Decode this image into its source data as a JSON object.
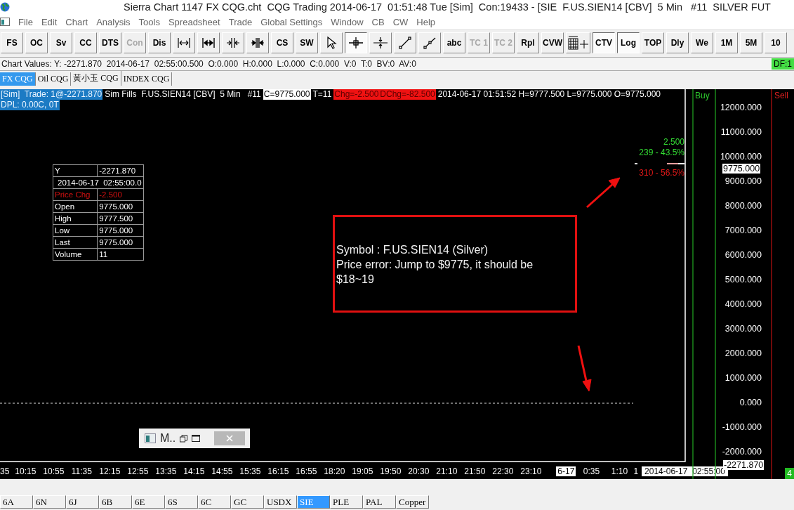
{
  "window": {
    "title": "Sierra Chart 1147 FX CQG.cht  CQG Trading 2014-06-17  01:51:48 Tue [Sim]  Con:19433 - [SIE  F.US.SIEN14 [CBV]  5 Min   #11  SILVER FUT"
  },
  "menu": {
    "items": [
      "File",
      "Edit",
      "Chart",
      "Analysis",
      "Tools",
      "Spreadsheet",
      "Trade",
      "Global Settings",
      "Window",
      "CB",
      "CW",
      "Help"
    ]
  },
  "toolbar": {
    "buttons": [
      {
        "kind": "text",
        "label": "FS",
        "disabled": false,
        "pressed": false
      },
      {
        "kind": "text",
        "label": "OC",
        "disabled": false,
        "pressed": false
      },
      {
        "kind": "text",
        "label": "Sv",
        "disabled": false,
        "pressed": false
      },
      {
        "kind": "text",
        "label": "CC",
        "disabled": false,
        "pressed": false
      },
      {
        "kind": "text",
        "label": "DTS",
        "disabled": false,
        "pressed": false
      },
      {
        "kind": "text",
        "label": "Con",
        "disabled": true,
        "pressed": false
      },
      {
        "kind": "text",
        "label": "Dis",
        "disabled": false,
        "pressed": false
      },
      {
        "kind": "expand",
        "disabled": false,
        "pressed": false
      },
      {
        "kind": "expandbold",
        "disabled": false,
        "pressed": false
      },
      {
        "kind": "compress",
        "disabled": false,
        "pressed": false
      },
      {
        "kind": "compressbold",
        "disabled": false,
        "pressed": false
      },
      {
        "kind": "text",
        "label": "CS",
        "disabled": false,
        "pressed": false
      },
      {
        "kind": "text",
        "label": "SW",
        "disabled": false,
        "pressed": false
      },
      {
        "kind": "pointer",
        "disabled": false,
        "pressed": false
      },
      {
        "kind": "crosshair",
        "disabled": false,
        "pressed": true
      },
      {
        "kind": "cross",
        "disabled": false,
        "pressed": false
      },
      {
        "kind": "line",
        "disabled": false,
        "pressed": false
      },
      {
        "kind": "ray",
        "disabled": false,
        "pressed": false
      },
      {
        "kind": "text",
        "label": "abc",
        "disabled": false,
        "pressed": false
      },
      {
        "kind": "text",
        "label": "TC 1",
        "disabled": true,
        "pressed": false
      },
      {
        "kind": "text",
        "label": "TC 2",
        "disabled": true,
        "pressed": false
      },
      {
        "kind": "text",
        "label": "Rpl",
        "disabled": false,
        "pressed": false
      },
      {
        "kind": "text",
        "label": "CVW",
        "disabled": false,
        "pressed": false
      },
      {
        "kind": "grid",
        "disabled": false,
        "pressed": false
      },
      {
        "kind": "text",
        "label": "CTV",
        "disabled": false,
        "pressed": true
      },
      {
        "kind": "text",
        "label": "Log",
        "disabled": false,
        "pressed": true
      },
      {
        "kind": "text",
        "label": "TOP",
        "disabled": false,
        "pressed": false
      },
      {
        "kind": "text",
        "label": "Dly",
        "disabled": false,
        "pressed": false
      },
      {
        "kind": "text",
        "label": "We",
        "disabled": false,
        "pressed": false
      },
      {
        "kind": "text",
        "label": "1M",
        "disabled": false,
        "pressed": false
      },
      {
        "kind": "text",
        "label": "5M",
        "disabled": false,
        "pressed": false
      },
      {
        "kind": "text",
        "label": "10",
        "disabled": false,
        "pressed": false
      }
    ]
  },
  "chart_values": {
    "text": "Chart Values: Y: -2271.870  2014-06-17  02:55:00.500  O:0.000  H:0.000  L:0.000  C:0.000  V:0  T:0  BV:0  AV:0",
    "data_feed": "DF:1"
  },
  "chartbook_tabs": [
    {
      "label": "FX CQG",
      "selected": true
    },
    {
      "label": "Oil CQG",
      "selected": false
    },
    {
      "label": "黃小玉 CQG",
      "selected": false
    },
    {
      "label": "INDEX CQG",
      "selected": false
    }
  ],
  "chart": {
    "header_segments": [
      {
        "kind": "sim",
        "text": "[Sim]  Trade: 1@-2271.870"
      },
      {
        "kind": "plain",
        "text": "Sim Fills  F.US.SIEN14 [CBV]  5 Min   #11"
      },
      {
        "kind": "inverse",
        "text": "C=9775.000"
      },
      {
        "kind": "plain",
        "text": "T=11"
      },
      {
        "kind": "alert",
        "text": "Chg=-2.500"
      },
      {
        "kind": "alert",
        "text": "DChg=-82.500"
      },
      {
        "kind": "plain",
        "text": "2014-06-17 01:51:52 H=9777.500 L=9775.000 O=9775.000"
      }
    ],
    "dpl": "DPL: 0.00C, 0T",
    "buy_label": "Buy",
    "sell_label": "Sell",
    "price_scale_labels": [
      "12000.000",
      "11000.000",
      "10000.000",
      "9000.000",
      "8000.000",
      "7000.000",
      "6000.000",
      "5000.000",
      "4000.000",
      "3000.000",
      "2000.000",
      "1000.000",
      "0.000",
      "-1000.000",
      "-2000.000"
    ],
    "price_tag": "9775.000",
    "cursor_price_tag": "-2271.870",
    "trade_stats": {
      "change": "2.500",
      "buy": "239 - 43.5%",
      "sell": "310 - 56.5%"
    },
    "data_window": [
      {
        "kind": "pair",
        "label": "Y",
        "value": "-2271.870"
      },
      {
        "kind": "span",
        "label": "2014-06-17  02:55:00.0"
      },
      {
        "kind": "alert",
        "label": "Price Chg",
        "value": "-2.500"
      },
      {
        "kind": "pair",
        "label": "Open",
        "value": "9775.000"
      },
      {
        "kind": "pair",
        "label": "High",
        "value": "9777.500"
      },
      {
        "kind": "pair",
        "label": "Low",
        "value": "9775.000"
      },
      {
        "kind": "pair",
        "label": "Last",
        "value": "9775.000"
      },
      {
        "kind": "pair",
        "label": "Volume",
        "value": "11"
      }
    ],
    "annotation": [
      "Symbol : F.US.SIEN14 (Silver)",
      "Price error: Jump to $9775, it should be $18~19"
    ],
    "mini_window": {
      "title": "M.."
    },
    "time_labels": [
      {
        "kind": "cut",
        "text": "35"
      },
      {
        "kind": "plain",
        "text": "10:15"
      },
      {
        "kind": "plain",
        "text": "10:55"
      },
      {
        "kind": "plain",
        "text": "11:35"
      },
      {
        "kind": "plain",
        "text": "12:15"
      },
      {
        "kind": "plain",
        "text": "12:55"
      },
      {
        "kind": "plain",
        "text": "13:35"
      },
      {
        "kind": "plain",
        "text": "14:15"
      },
      {
        "kind": "plain",
        "text": "14:55"
      },
      {
        "kind": "plain",
        "text": "15:35"
      },
      {
        "kind": "plain",
        "text": "16:15"
      },
      {
        "kind": "plain",
        "text": "16:55"
      },
      {
        "kind": "plain",
        "text": "18:20"
      },
      {
        "kind": "plain",
        "text": "19:05"
      },
      {
        "kind": "plain",
        "text": "19:50"
      },
      {
        "kind": "plain",
        "text": "20:30"
      },
      {
        "kind": "plain",
        "text": "21:10"
      },
      {
        "kind": "plain",
        "text": "21:50"
      },
      {
        "kind": "plain",
        "text": "22:30"
      },
      {
        "kind": "plain",
        "text": "23:10"
      },
      {
        "kind": "date",
        "text": "6-17"
      },
      {
        "kind": "plain",
        "text": "0:35"
      },
      {
        "kind": "plain",
        "text": "1:10"
      },
      {
        "kind": "cut",
        "text": "1"
      },
      {
        "kind": "cursor",
        "text": "2014-06-17  02:55:00"
      }
    ],
    "status_count": "4"
  },
  "bottom_tabs": [
    {
      "label": "6A",
      "selected": false
    },
    {
      "label": "6N",
      "selected": false
    },
    {
      "label": "6J",
      "selected": false
    },
    {
      "label": "6B",
      "selected": false
    },
    {
      "label": "6E",
      "selected": false
    },
    {
      "label": "6S",
      "selected": false
    },
    {
      "label": "6C",
      "selected": false
    },
    {
      "label": "GC",
      "selected": false
    },
    {
      "label": "USDX",
      "selected": false
    },
    {
      "label": "SIE",
      "selected": true
    },
    {
      "label": "PLE",
      "selected": false
    },
    {
      "label": "PAL",
      "selected": false
    },
    {
      "label": "Copper",
      "selected": false
    }
  ]
}
